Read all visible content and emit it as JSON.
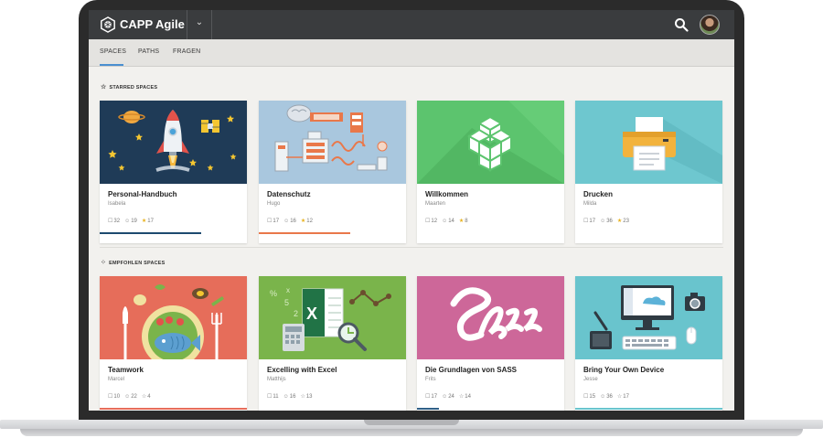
{
  "app": {
    "title": "CAPP Agile"
  },
  "tabs": [
    {
      "label": "SPACES",
      "active": true
    },
    {
      "label": "PATHS",
      "active": false
    },
    {
      "label": "FRAGEN",
      "active": false
    }
  ],
  "starred": {
    "heading": "STARRED SPACES",
    "cards": [
      {
        "title": "Personal-Handbuch",
        "owner": "Isabela",
        "bookmarks": "32",
        "users": "19",
        "stars": "17",
        "progress": 0.69,
        "progress_color": "#1d4a6f"
      },
      {
        "title": "Datenschutz",
        "owner": "Hugo",
        "bookmarks": "17",
        "users": "16",
        "stars": "12",
        "progress": 0.62,
        "progress_color": "#e9784a"
      },
      {
        "title": "Willkommen",
        "owner": "Maarten",
        "bookmarks": "12",
        "users": "14",
        "stars": "8",
        "progress": 0,
        "progress_color": "#5cc46e"
      },
      {
        "title": "Drucken",
        "owner": "Milda",
        "bookmarks": "17",
        "users": "36",
        "stars": "23",
        "progress": 0,
        "progress_color": "#6ec7cf"
      }
    ]
  },
  "recommended": {
    "heading": "EMPFOHLEN SPACES",
    "cards": [
      {
        "title": "Teamwork",
        "owner": "Marcel",
        "bookmarks": "10",
        "users": "22",
        "stars": "4",
        "progress": 1,
        "progress_color": "#e66d5a"
      },
      {
        "title": "Excelling with Excel",
        "owner": "Matthijs",
        "bookmarks": "11",
        "users": "16",
        "stars": "13",
        "progress": 0,
        "progress_color": "#7ab44b"
      },
      {
        "title": "Die Grundlagen von SASS",
        "owner": "Frits",
        "bookmarks": "17",
        "users": "24",
        "stars": "14",
        "progress": 0.15,
        "progress_color": "#2f5f87"
      },
      {
        "title": "Bring Your Own Device",
        "owner": "Jesse",
        "bookmarks": "15",
        "users": "36",
        "stars": "17",
        "progress": 1,
        "progress_color": "#69c4cd"
      }
    ]
  },
  "colors": {
    "topbar": "#3a3c3e",
    "accent": "#4a8fd0",
    "star": "#e8b21c"
  }
}
